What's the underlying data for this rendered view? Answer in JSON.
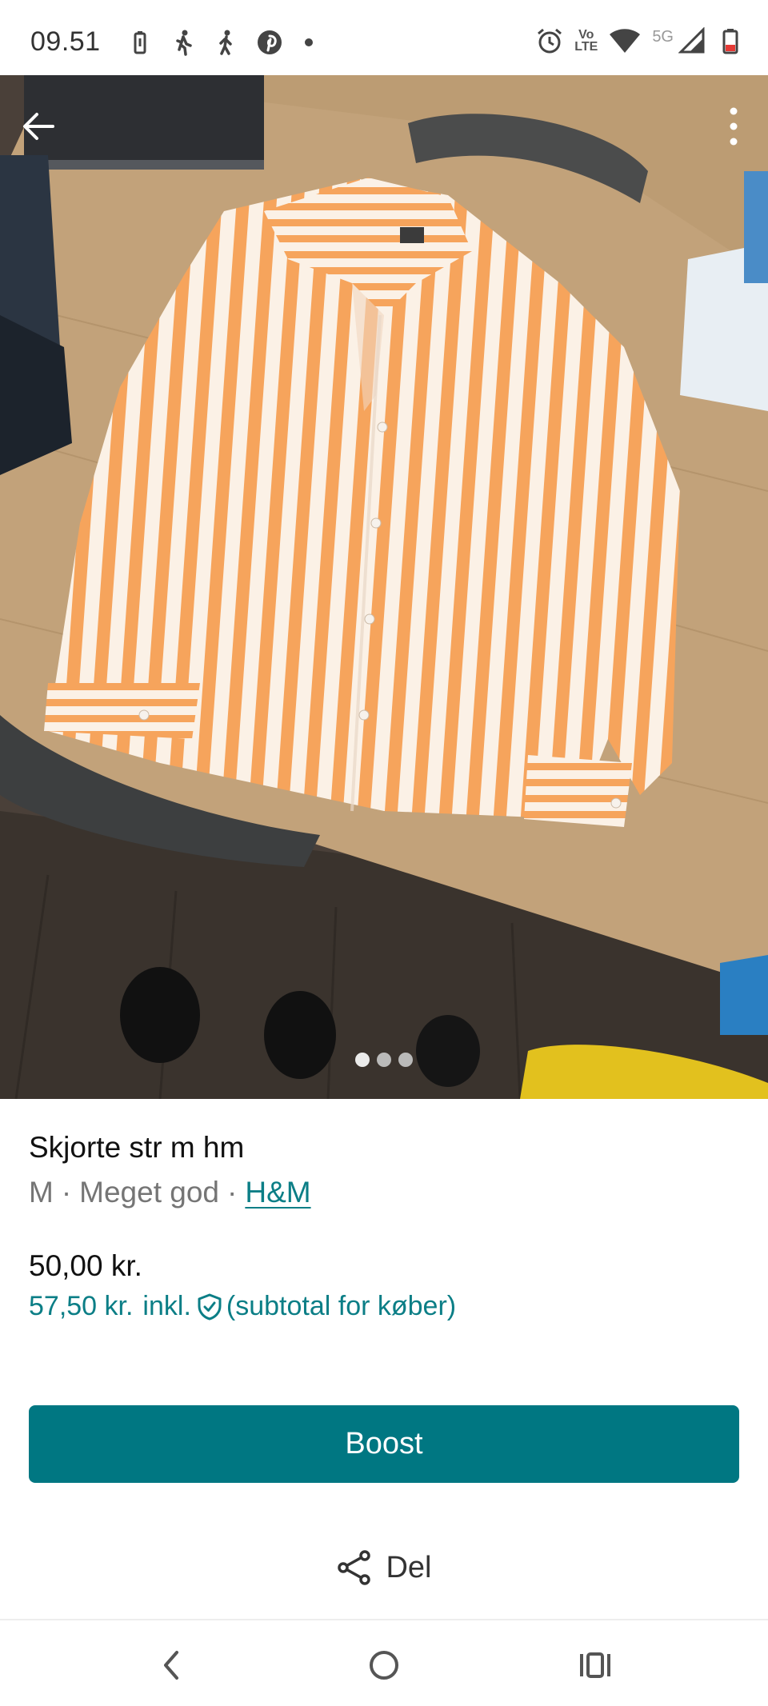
{
  "status_bar": {
    "time": "09.51",
    "left_icons": [
      "battery-saver-icon",
      "walking-icon",
      "walking-icon",
      "pinterest-icon",
      "dot-icon"
    ],
    "right_icons": [
      "alarm-icon",
      "volte-icon",
      "wifi-icon",
      "5g-icon",
      "signal-icon",
      "battery-icon"
    ],
    "volte_line1": "Vo",
    "volte_line2": "LTE",
    "network": "5G"
  },
  "hero": {
    "image_description_icon": "product-photo",
    "pages_total": 3,
    "current_page": 1
  },
  "listing": {
    "title": "Skjorte str m hm",
    "size": "M",
    "condition": "Meget god",
    "brand": "H&M",
    "separator": "·",
    "price": "50,00 kr.",
    "price_incl_amount": "57,50 kr.",
    "price_incl_word": "inkl.",
    "price_incl_note": "(subtotal for køber)"
  },
  "actions": {
    "boost_label": "Boost",
    "share_label": "Del"
  },
  "colors": {
    "accent": "#007782",
    "link": "#0b7e86",
    "muted_text": "#757575"
  }
}
